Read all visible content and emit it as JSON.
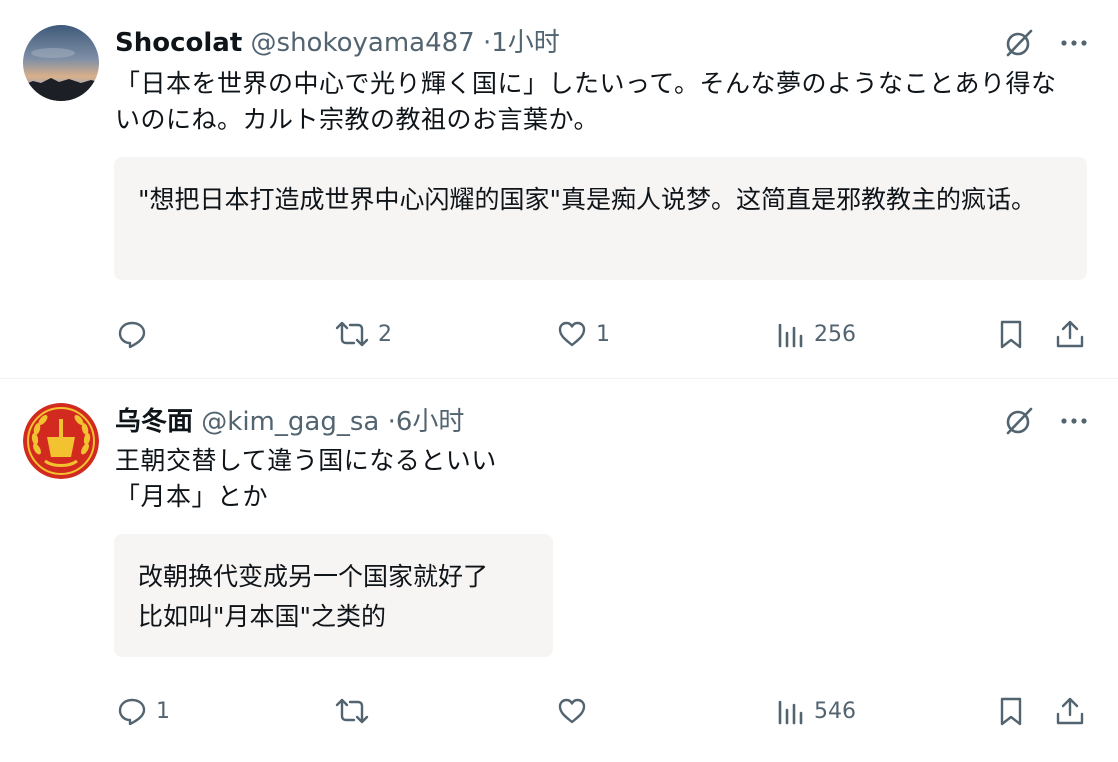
{
  "tweets": [
    {
      "name": "Shocolat",
      "handle": "@shokoyama487",
      "separator": "·",
      "time": "1小时",
      "text": "「日本を世界の中心で光り輝く国に」したいって。そんな夢のようなことあり得ないのにね。カルト宗教の教祖のお言葉か。",
      "translation": "\"想把日本打造成世界中心闪耀的国家\"真是痴人说梦。这简直是邪教教主的疯话。",
      "replies": "",
      "retweets": "2",
      "likes": "1",
      "views": "256",
      "avatar": "sunset-sky-avatar"
    },
    {
      "name": "乌冬面",
      "handle": "@kim_gag_sa",
      "separator": "·",
      "time": "6小时",
      "text": "王朝交替して違う国になるといい\n「月本」とか",
      "translation": "改朝换代变成另一个国家就好了\n比如叫\"月本国\"之类的",
      "replies": "1",
      "retweets": "",
      "likes": "",
      "views": "546",
      "avatar": "red-emblem-avatar"
    }
  ],
  "colors": {
    "text": "#0f1419",
    "muted": "#536471",
    "translation_bg": "#f7f5f4",
    "divider": "#eff3f4",
    "emblem_red": "#d32a1f",
    "emblem_gold": "#f2c230"
  }
}
